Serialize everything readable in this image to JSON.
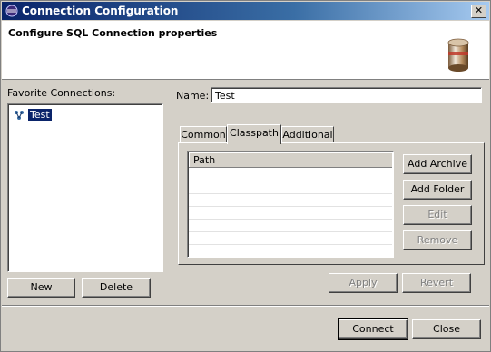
{
  "window": {
    "title": "Connection Configuration",
    "close_glyph": "✕"
  },
  "header": {
    "title": "Configure SQL Connection properties",
    "icon": "database-icon"
  },
  "favorites": {
    "label": "Favorite Connections:",
    "items": [
      {
        "label": "Test",
        "icon": "connection-icon",
        "selected": true
      }
    ],
    "new_label": "New",
    "delete_label": "Delete"
  },
  "name_field": {
    "label": "Name:",
    "value": "Test"
  },
  "tabs": [
    {
      "label": "Common",
      "active": false
    },
    {
      "label": "Classpath",
      "active": true
    },
    {
      "label": "Additional",
      "active": false
    }
  ],
  "classpath": {
    "column_header": "Path",
    "rows": [
      "",
      "",
      "",
      "",
      "",
      "",
      ""
    ],
    "buttons": {
      "add_archive": "Add Archive",
      "add_folder": "Add Folder",
      "edit": "Edit",
      "remove": "Remove"
    }
  },
  "apply_label": "Apply",
  "revert_label": "Revert",
  "connect_label": "Connect",
  "close_label": "Close"
}
